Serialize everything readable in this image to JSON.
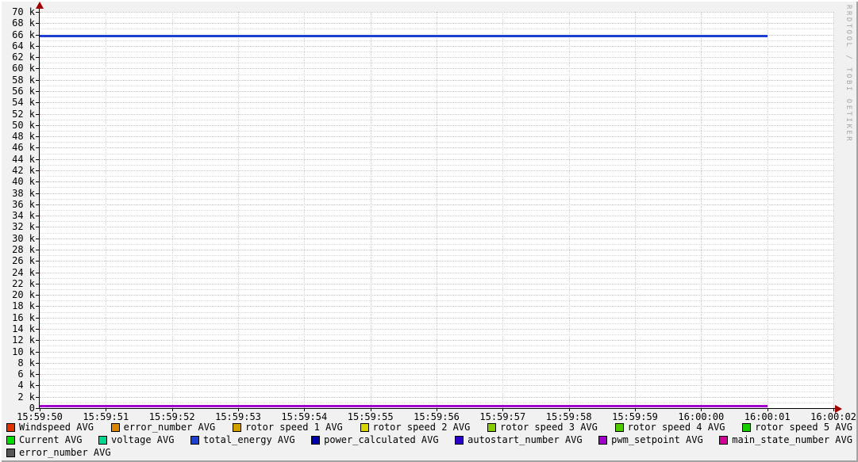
{
  "watermark": "RRDTOOL / TOBI OETIKER",
  "chart_data": {
    "type": "line",
    "title": "",
    "xlabel": "",
    "ylabel": "",
    "grid": true,
    "legend_position": "bottom",
    "ylim": [
      0,
      70000
    ],
    "y_tick_step": 2000,
    "y_tick_labels": [
      "70 k",
      "68 k",
      "66 k",
      "64 k",
      "62 k",
      "60 k",
      "58 k",
      "56 k",
      "54 k",
      "52 k",
      "50 k",
      "48 k",
      "46 k",
      "44 k",
      "42 k",
      "40 k",
      "38 k",
      "36 k",
      "34 k",
      "32 k",
      "30 k",
      "28 k",
      "26 k",
      "24 k",
      "22 k",
      "20 k",
      "18 k",
      "16 k",
      "14 k",
      "12 k",
      "10 k",
      "8 k",
      "6 k",
      "4 k",
      "2 k",
      "0"
    ],
    "x_tick_labels": [
      "15:59:50",
      "15:59:51",
      "15:59:52",
      "15:59:53",
      "15:59:54",
      "15:59:55",
      "15:59:56",
      "15:59:57",
      "15:59:58",
      "15:59:59",
      "16:00:00",
      "16:00:01",
      "16:00:02"
    ],
    "x_major_red_indices": [
      5,
      10
    ],
    "series": [
      {
        "name": "total_energy AVG",
        "color": "#1d3fd2",
        "style": "line",
        "value_approx": 65700,
        "thickness": 3,
        "x_start": "15:59:50",
        "x_end": "16:00:01"
      },
      {
        "name": "pwm_setpoint AVG",
        "color": "#a200cc",
        "style": "line",
        "value_approx": 400,
        "thickness": 3,
        "x_start": "15:59:50",
        "x_end": "16:00:01"
      }
    ]
  },
  "legend_rows": [
    [
      {
        "label": "Windspeed AVG",
        "color": "#e23200"
      },
      {
        "label": "error_number AVG",
        "color": "#dd8500"
      },
      {
        "label": "rotor speed 1 AVG",
        "color": "#cfa000"
      },
      {
        "label": "rotor speed 2 AVG",
        "color": "#d8d800"
      },
      {
        "label": "rotor speed 3 AVG",
        "color": "#85cc00"
      },
      {
        "label": "rotor speed 4 AVG",
        "color": "#4ecc00"
      },
      {
        "label": "rotor speed 5 AVG",
        "color": "#17cc00"
      }
    ],
    [
      {
        "label": "Current AVG",
        "color": "#00e000"
      },
      {
        "label": "voltage AVG",
        "color": "#00d68e"
      },
      {
        "label": "total_energy AVG",
        "color": "#1d3fd2"
      },
      {
        "label": "power_calculated AVG",
        "color": "#0000aa"
      },
      {
        "label": "autostart_number AVG",
        "color": "#2b00c8"
      },
      {
        "label": "pwm_setpoint AVG",
        "color": "#a200cc"
      },
      {
        "label": "main_state_number AVG",
        "color": "#d60096"
      }
    ],
    [
      {
        "label": "error_number AVG",
        "color": "#555555"
      }
    ]
  ]
}
